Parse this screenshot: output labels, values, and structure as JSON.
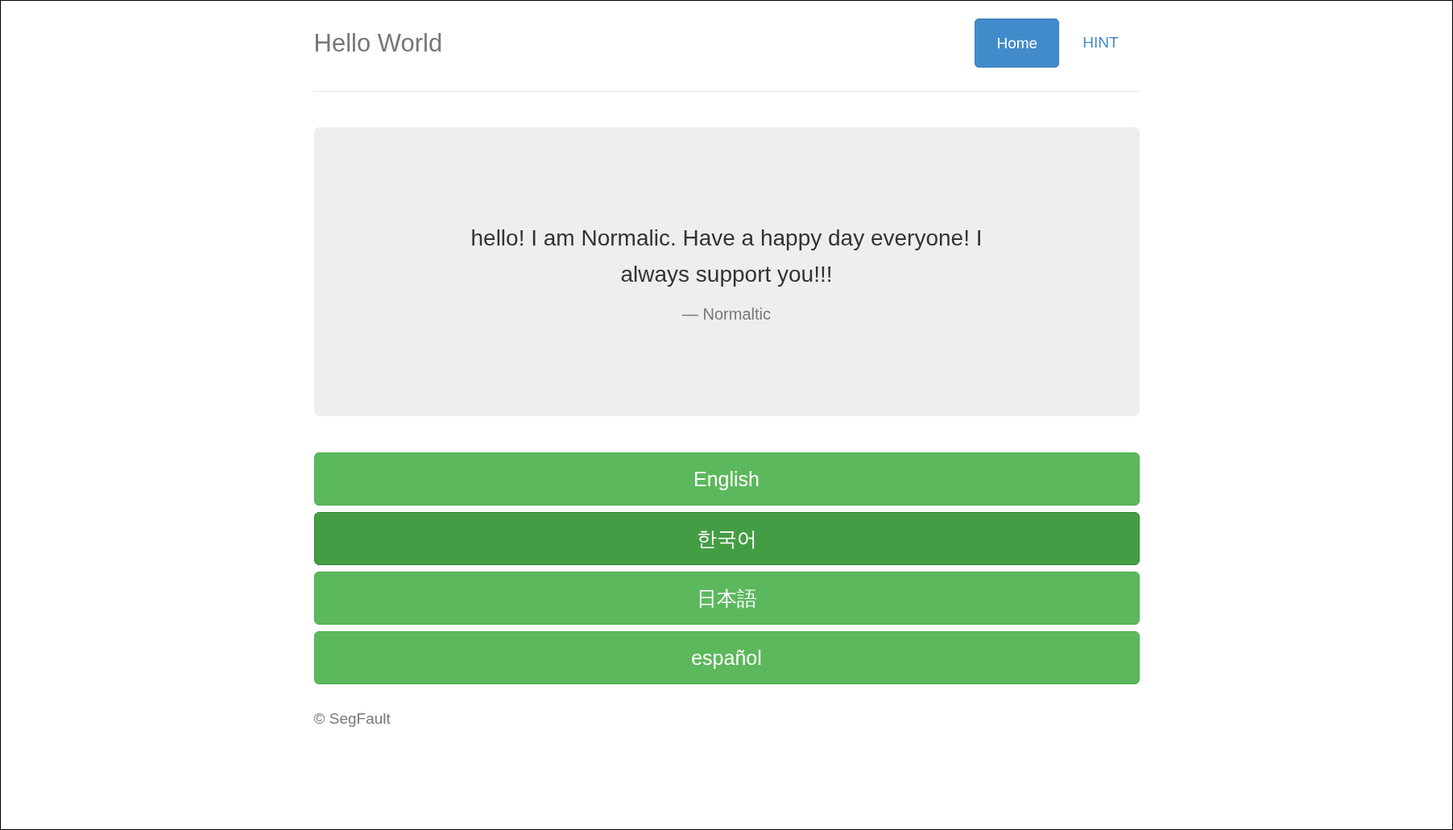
{
  "header": {
    "title": "Hello World",
    "nav": [
      {
        "label": "Home",
        "selected": true
      },
      {
        "label": "HINT",
        "selected": false
      }
    ]
  },
  "quote": {
    "text": "hello! I am Normalic. Have a happy day everyone! I always support you!!!",
    "citation": "— Normaltic"
  },
  "languages": [
    {
      "label": "English",
      "selected": false
    },
    {
      "label": "한국어",
      "selected": true
    },
    {
      "label": "日本語",
      "selected": false
    },
    {
      "label": "español",
      "selected": false
    }
  ],
  "footer": "© SegFault"
}
